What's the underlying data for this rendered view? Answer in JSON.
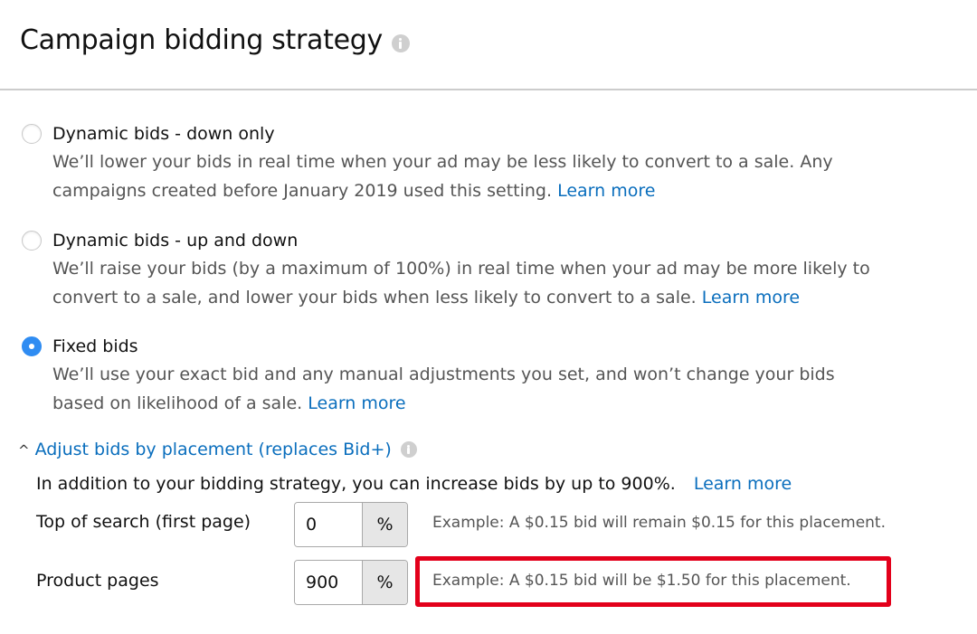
{
  "header": {
    "title": "Campaign bidding strategy",
    "info_icon": "info-icon"
  },
  "strategy": {
    "selected": "fixed",
    "options": [
      {
        "id": "down-only",
        "label": "Dynamic bids - down only",
        "description": "We’ll lower your bids in real time when your ad may be less likely to convert to a sale. Any campaigns created before January 2019 used this setting.",
        "link": "Learn more",
        "checked": false
      },
      {
        "id": "up-and-down",
        "label": "Dynamic bids - up and down",
        "description": "We’ll raise your bids (by a maximum of 100%) in real time when your ad may be more likely to convert to a sale, and lower your bids when less likely to convert to a sale.",
        "link": "Learn more",
        "checked": false
      },
      {
        "id": "fixed",
        "label": "Fixed bids",
        "description": "We’ll use your exact bid and any manual adjustments you set, and won’t change your bids based on likelihood of a sale.",
        "link": "Learn more",
        "checked": true
      }
    ]
  },
  "placement": {
    "toggle_icon": "caret-up-icon",
    "toggle_label": "Adjust bids by placement (replaces Bid+)",
    "intro": "In addition to your bidding strategy, you can increase bids by up to 900%.",
    "intro_link": "Learn more",
    "rows": [
      {
        "label": "Top of search (first page)",
        "value": "0",
        "suffix": "%",
        "example": "Example: A $0.15 bid will remain $0.15 for this placement.",
        "highlighted": false
      },
      {
        "label": "Product pages",
        "value": "900",
        "suffix": "%",
        "example": "Example: A $0.15 bid will be $1.50 for this placement.",
        "highlighted": true
      }
    ]
  },
  "colors": {
    "link": "#0a6ebd",
    "radio_selected": "#2f8cf2",
    "highlight_border": "#e3001b"
  }
}
